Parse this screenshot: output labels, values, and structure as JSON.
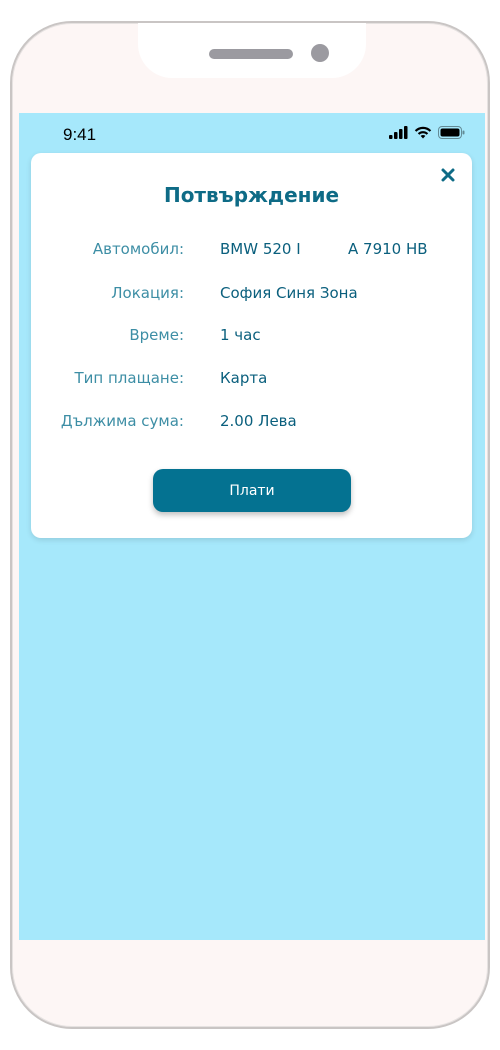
{
  "status_bar": {
    "time": "9:41",
    "icons": [
      "signal-icon",
      "wifi-icon",
      "battery-icon"
    ]
  },
  "modal": {
    "title": "Потвърждение",
    "close_icon": "close-icon",
    "rows": [
      {
        "label": "Автомобил:",
        "value": "BMW 520 I",
        "value2": "A 7910 HB"
      },
      {
        "label": "Локация:",
        "value": "София Синя Зона"
      },
      {
        "label": "Време:",
        "value": "1 час"
      },
      {
        "label": "Тип плащане:",
        "value": "Карта"
      },
      {
        "label": "Дължима сума:",
        "value": "2.00 Лева"
      }
    ],
    "pay_button_label": "Плати"
  },
  "colors": {
    "screen_background": "#a6e8fb",
    "accent": "#047291",
    "title": "#0e6b86",
    "label": "#3d8ea5"
  }
}
